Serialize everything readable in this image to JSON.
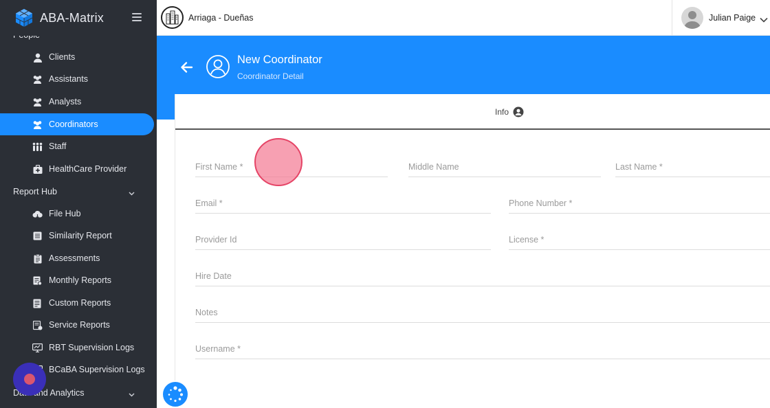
{
  "app": {
    "name": "ABA-Matrix"
  },
  "sidebar": {
    "section_people_partial": "People",
    "items_people": [
      {
        "label": "Clients",
        "icon": "user-icon"
      },
      {
        "label": "Assistants",
        "icon": "users-icon"
      },
      {
        "label": "Analysts",
        "icon": "users-icon"
      },
      {
        "label": "Coordinators",
        "icon": "users-icon",
        "active": true
      },
      {
        "label": "Staff",
        "icon": "people-group-icon"
      },
      {
        "label": "HealthCare Provider",
        "icon": "medkit-icon"
      }
    ],
    "section_report_hub": "Report Hub",
    "items_reports": [
      {
        "label": "File Hub",
        "icon": "cloud-icon"
      },
      {
        "label": "Similarity Report",
        "icon": "list-icon"
      },
      {
        "label": "Assessments",
        "icon": "clipboard-icon"
      },
      {
        "label": "Monthly Reports",
        "icon": "report-icon"
      },
      {
        "label": "Custom Reports",
        "icon": "report-icon"
      },
      {
        "label": "Service Reports",
        "icon": "report-icon"
      },
      {
        "label": "RBT Supervision Logs",
        "icon": "monitor-icon"
      },
      {
        "label": "BCaBA Supervision Logs",
        "icon": "monitor-icon"
      }
    ],
    "section_data_analytics": "Data and Analytics"
  },
  "topbar": {
    "org_name": "Arriaga - Dueñas",
    "user_name": "Julian Paige"
  },
  "header": {
    "title": "New Coordinator",
    "subtitle": "Coordinator Detail"
  },
  "tabs": {
    "info": "Info"
  },
  "form": {
    "first_name": "First Name *",
    "middle_name": "Middle Name",
    "last_name": "Last Name *",
    "email": "Email *",
    "phone": "Phone Number *",
    "provider_id": "Provider Id",
    "license": "License *",
    "hire_date": "Hire Date",
    "notes": "Notes",
    "username": "Username *"
  },
  "colors": {
    "accent": "#1a8cff",
    "sidebar_bg": "#2b2f36"
  }
}
